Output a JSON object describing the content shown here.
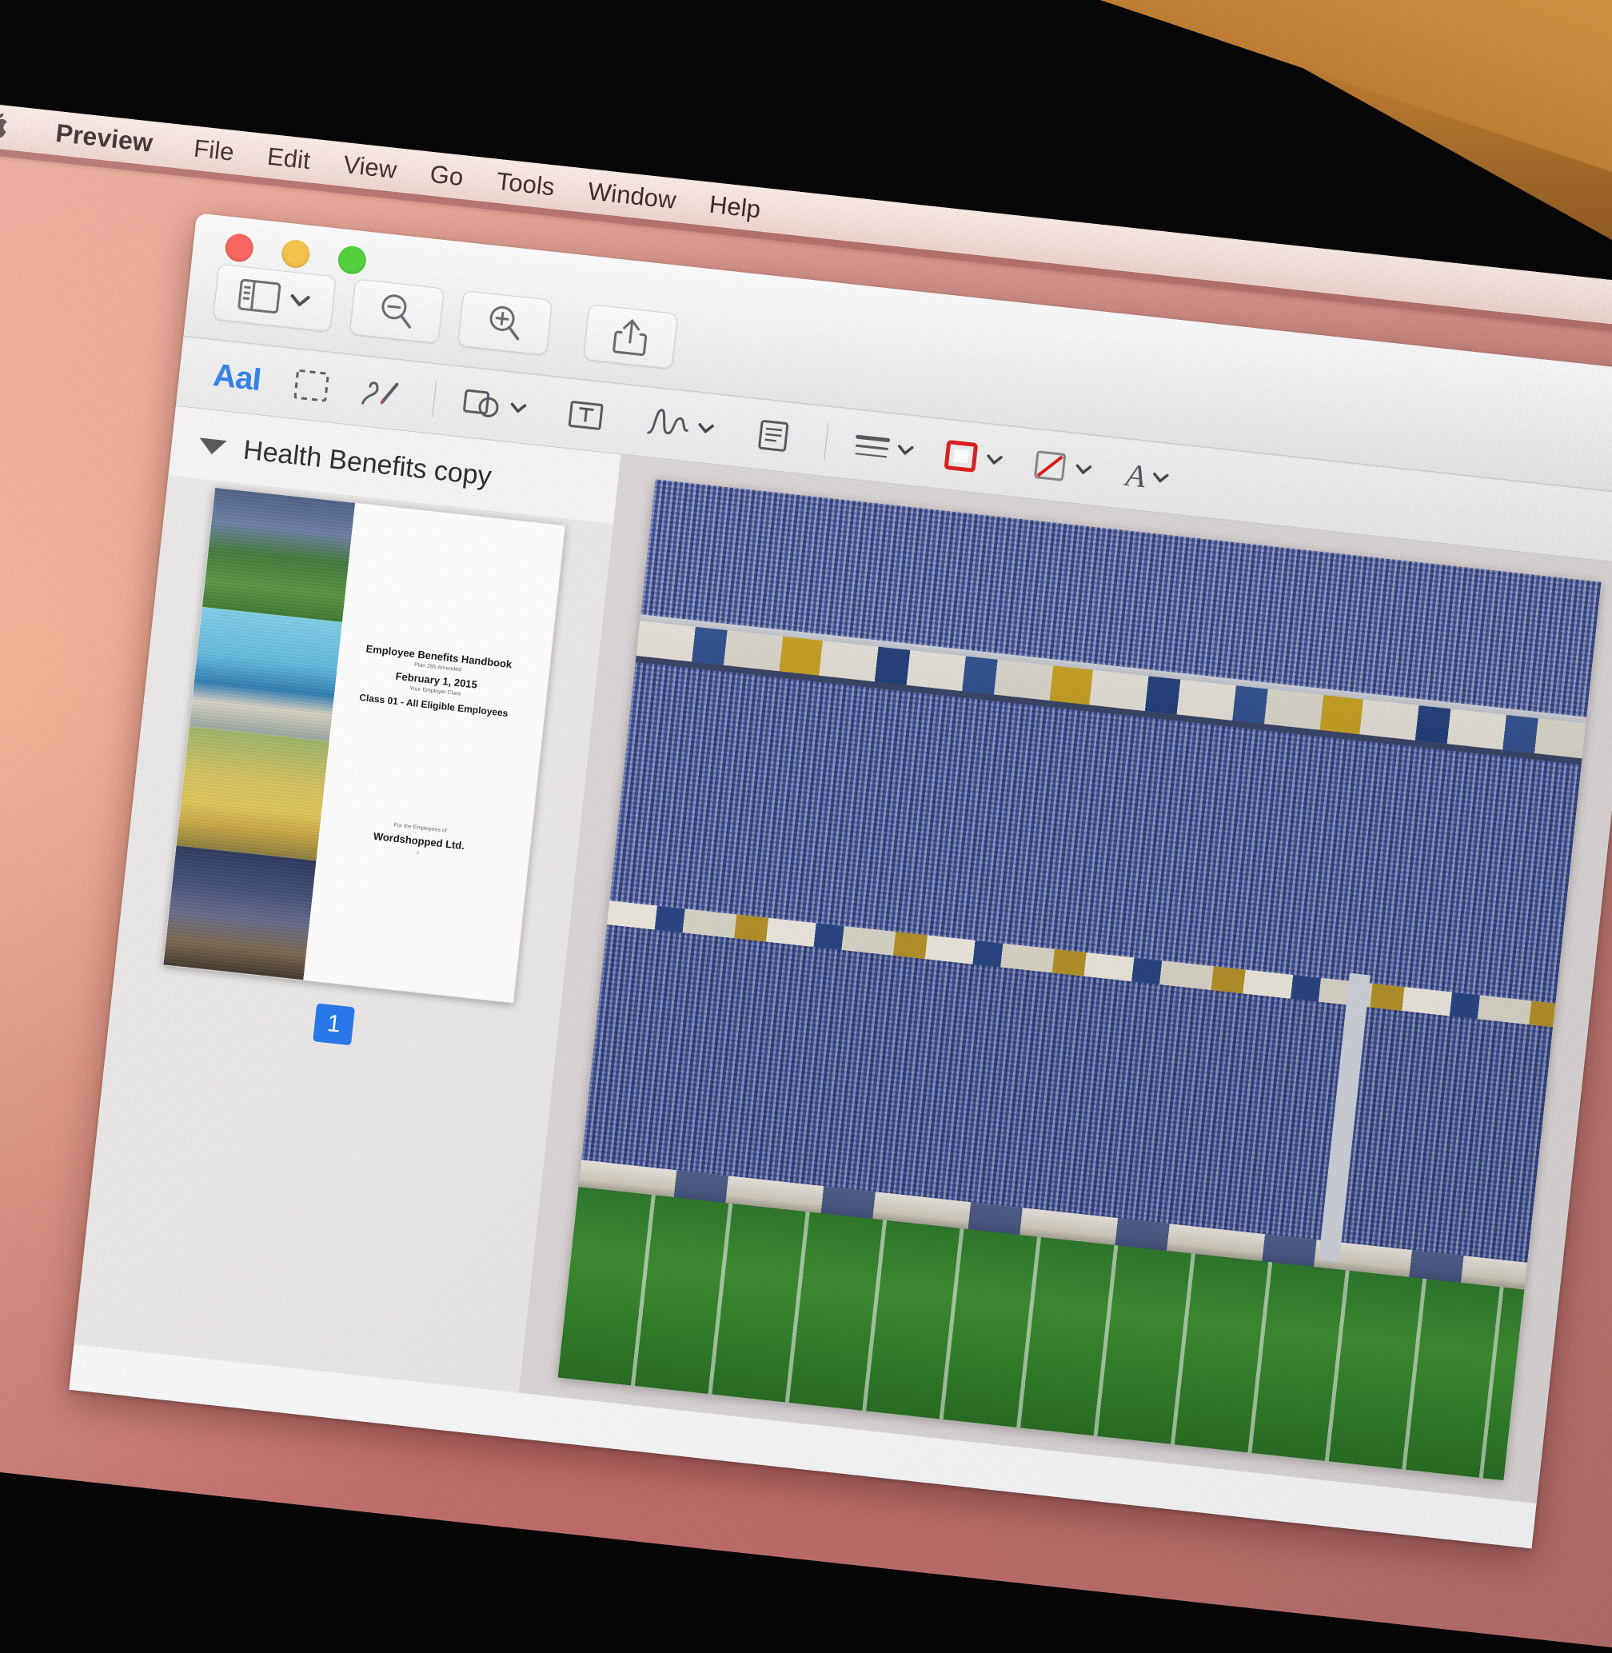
{
  "menubar": {
    "apple_icon": "apple-logo-icon",
    "items": [
      {
        "label": "Preview",
        "bold": true
      },
      {
        "label": "File"
      },
      {
        "label": "Edit"
      },
      {
        "label": "View"
      },
      {
        "label": "Go"
      },
      {
        "label": "Tools"
      },
      {
        "label": "Window"
      },
      {
        "label": "Help"
      }
    ]
  },
  "window": {
    "traffic_lights": {
      "close_color": "#fc6058",
      "minimize_color": "#f6c344",
      "zoom_color": "#4fd338"
    },
    "toolbar": [
      {
        "name": "sidebar-view-button",
        "icon": "sidebar-icon",
        "has_chevron": true
      },
      {
        "name": "zoom-out-button",
        "icon": "magnifier-minus-icon"
      },
      {
        "name": "zoom-in-button",
        "icon": "magnifier-plus-icon"
      },
      {
        "name": "share-button",
        "icon": "share-icon"
      }
    ],
    "markup_toolbar": [
      {
        "name": "text-selection-tool",
        "icon": "aa-text-icon",
        "label": "AaI",
        "selected": true
      },
      {
        "name": "rectangular-selection-tool",
        "icon": "marquee-selection-icon"
      },
      {
        "name": "sketch-tool",
        "icon": "sketch-pen-icon"
      },
      {
        "name": "shapes-tool",
        "icon": "shapes-icon",
        "has_chevron": true
      },
      {
        "name": "text-tool",
        "icon": "text-box-icon"
      },
      {
        "name": "signature-tool",
        "icon": "signature-icon",
        "has_chevron": true
      },
      {
        "name": "note-tool",
        "icon": "note-icon"
      },
      {
        "name": "shape-style-tool",
        "icon": "line-style-icon",
        "has_chevron": true
      },
      {
        "name": "border-color-tool",
        "icon": "border-color-icon",
        "has_chevron": true,
        "color": "#e02020"
      },
      {
        "name": "fill-color-tool",
        "icon": "fill-color-icon",
        "has_chevron": true,
        "color": "#e02020"
      },
      {
        "name": "text-style-tool",
        "icon": "font-a-icon",
        "has_chevron": true
      }
    ]
  },
  "sidebar": {
    "disclosure_icon": "disclosure-triangle-down-icon",
    "title": "Health Benefits copy",
    "page_badge": "1",
    "thumbnail": {
      "lines": [
        "Employee Benefits Handbook",
        "Plan 285 Amended",
        "February 1, 2015",
        "Your Employer Clara",
        "Class 01 - All Eligible Employees",
        "For the Employees of",
        "Wordshopped Ltd.",
        "2"
      ],
      "photos": [
        "stadium-photo",
        "city-harbour-photo",
        "farm-combine-photo",
        "concert-crowd-photo"
      ]
    }
  },
  "content": {
    "page_image": "stadium-crowd-photo"
  }
}
